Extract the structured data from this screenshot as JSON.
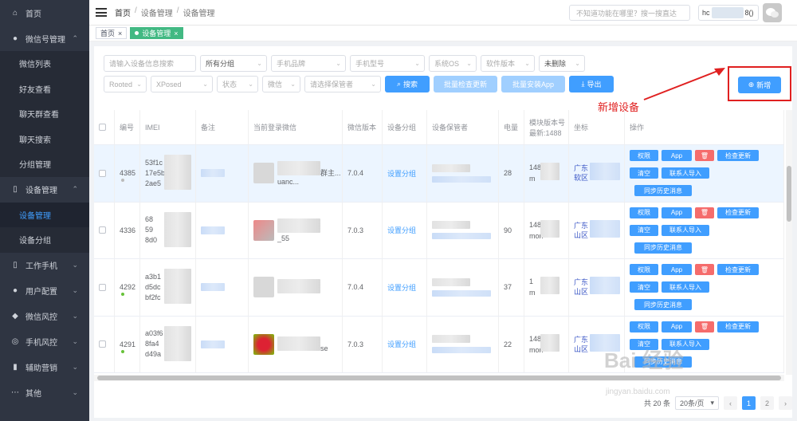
{
  "sidebar": {
    "items": [
      {
        "label": "首页",
        "icon": "home-icon",
        "glyph": "⌂"
      },
      {
        "label": "微信号管理",
        "icon": "wechat-icon",
        "glyph": "●",
        "expanded": true,
        "children": [
          "微信列表",
          "好友查看",
          "聊天群查看",
          "聊天搜索",
          "分组管理"
        ]
      },
      {
        "label": "设备管理",
        "icon": "phone-icon",
        "glyph": "▯",
        "expanded": true,
        "children": [
          "设备管理",
          "设备分组"
        ]
      },
      {
        "label": "工作手机",
        "icon": "mobile-icon",
        "glyph": "▯"
      },
      {
        "label": "用户配置",
        "icon": "user-icon",
        "glyph": "●"
      },
      {
        "label": "微信风控",
        "icon": "shield-icon",
        "glyph": "◆"
      },
      {
        "label": "手机风控",
        "icon": "globe-icon",
        "glyph": "◎"
      },
      {
        "label": "辅助营销",
        "icon": "chart-icon",
        "glyph": "▮"
      },
      {
        "label": "其他",
        "icon": "more-icon",
        "glyph": "⋯"
      }
    ]
  },
  "header": {
    "breadcrumb": [
      "首页",
      "设备管理",
      "设备管理"
    ],
    "search_placeholder": "不知道功能在哪里？搜一搜直达",
    "user_prefix": "hc",
    "user_suffix": "8()"
  },
  "tags": [
    {
      "label": "首页",
      "close": "×"
    },
    {
      "label": "设备管理",
      "close": "×"
    }
  ],
  "filters": {
    "row1": [
      {
        "text": "请输入设备信息搜索",
        "w": 116
      },
      {
        "text": "所有分组",
        "w": 84,
        "val": true
      },
      {
        "text": "手机品牌",
        "w": 94
      },
      {
        "text": "手机型号",
        "w": 94
      },
      {
        "text": "系统OS",
        "w": 60
      },
      {
        "text": "软件版本",
        "w": 68
      },
      {
        "text": "未删除",
        "w": 58,
        "val": true
      }
    ],
    "row2": [
      {
        "text": "Rooted",
        "w": 54
      },
      {
        "text": "XPosed",
        "w": 78
      },
      {
        "text": "状态",
        "w": 52
      },
      {
        "text": "微信",
        "w": 48
      },
      {
        "text": "请选择保管者",
        "w": 96
      }
    ],
    "search_btn": "搜索",
    "batch_update_btn": "批量检查更新",
    "batch_install_btn": "批量安装App",
    "export_btn": "导出",
    "add_btn": "新增"
  },
  "annotation": "新增设备",
  "table": {
    "headers": [
      "编号",
      "IMEI",
      "备注",
      "当前登录微信",
      "微信版本",
      "设备分组",
      "设备保管者",
      "电量",
      "模块版本号\n最新:1488",
      "坐标",
      "操作"
    ],
    "rows": [
      {
        "id": "4385",
        "imei": [
          "53f1c",
          "17e5b",
          "2ae5"
        ],
        "wx_name": "群主...",
        "wx_sub": "uanc...",
        "wx_version": "7.0.4",
        "group": "设置分组",
        "battery": "28",
        "module": [
          "148",
          "m"
        ],
        "coord": [
          "广东",
          "软区"
        ],
        "status": "#bbbbbb"
      },
      {
        "id": "4336",
        "imei": [
          "68",
          "59",
          "8d0"
        ],
        "wx_name": "",
        "wx_sub": "_55",
        "wx_version": "7.0.3",
        "group": "设置分组",
        "battery": "90",
        "module": [
          "148",
          "mon"
        ],
        "coord": [
          "广东",
          "山区"
        ],
        "status": ""
      },
      {
        "id": "4292",
        "imei": [
          "a3b1",
          "d5dc",
          "bf2fc"
        ],
        "wx_name": "",
        "wx_sub": "",
        "wx_version": "7.0.4",
        "group": "设置分组",
        "battery": "37",
        "module": [
          "1",
          "m"
        ],
        "coord": [
          "广东",
          "山区"
        ],
        "status": "#67c23a"
      },
      {
        "id": "4291",
        "imei": [
          "a03f6",
          "8fa4",
          "d49a"
        ],
        "wx_name": "se",
        "wx_sub": "",
        "wx_version": "7.0.3",
        "group": "设置分组",
        "battery": "22",
        "module": [
          "148",
          "mon"
        ],
        "coord": [
          "广东",
          "山区"
        ],
        "status": "#67c23a"
      }
    ],
    "ops": [
      "权限",
      "App",
      "🗑",
      "检查更新",
      "清空",
      "联系人导入",
      "同步历史消息"
    ]
  },
  "pagination": {
    "total": "共 20 条",
    "page_size": "20条/页",
    "pages": [
      "1",
      "2"
    ],
    "prev": "‹",
    "next": "›"
  },
  "watermark": {
    "brand": "Bai 经验",
    "url": "jingyan.baidu.com"
  },
  "colors": {
    "primary": "#409eff",
    "danger": "#f56c6c",
    "success": "#42b983",
    "sidebar": "#2f3542",
    "annotation": "#e02020"
  }
}
